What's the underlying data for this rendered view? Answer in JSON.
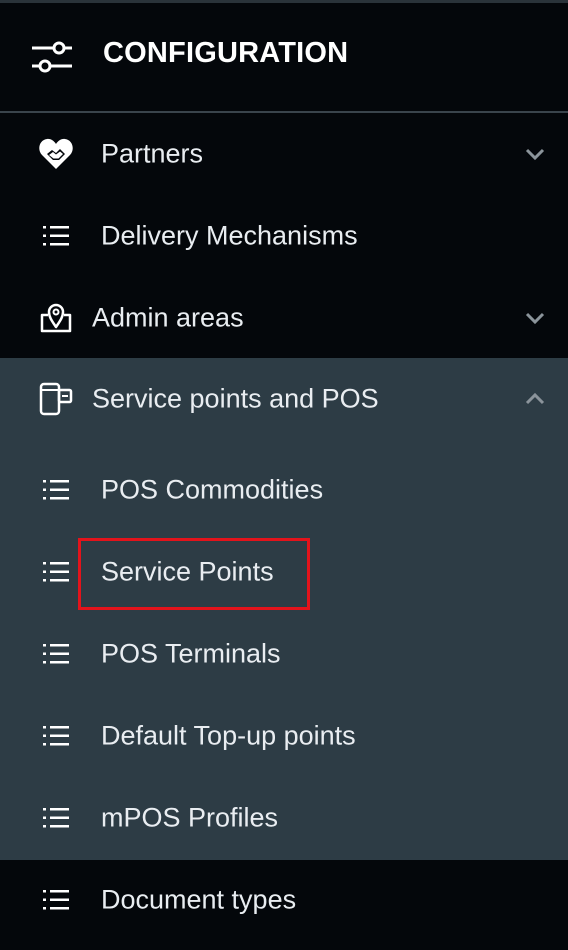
{
  "header": {
    "title": "CONFIGURATION",
    "icon": "sliders-icon"
  },
  "menu": [
    {
      "label": "Partners",
      "icon": "handshake-heart-icon",
      "chevron": "down"
    },
    {
      "label": "Delivery Mechanisms",
      "icon": "list-icon"
    },
    {
      "label": "Admin areas",
      "icon": "map-pin-icon",
      "chevron": "down"
    },
    {
      "label": "Service points and POS",
      "icon": "pos-terminal-icon",
      "chevron": "up",
      "expanded": true,
      "children": [
        {
          "label": "POS Commodities",
          "icon": "list-icon"
        },
        {
          "label": "Service Points",
          "icon": "list-icon",
          "highlighted": true
        },
        {
          "label": "POS Terminals",
          "icon": "list-icon"
        },
        {
          "label": "Default Top-up points",
          "icon": "list-icon"
        },
        {
          "label": "mPOS Profiles",
          "icon": "list-icon"
        }
      ]
    },
    {
      "label": "Document types",
      "icon": "list-icon"
    }
  ],
  "colors": {
    "background": "#04070b",
    "submenu_background": "#2d3c45",
    "highlight_border": "#e3131b",
    "text": "#e9edf1"
  }
}
